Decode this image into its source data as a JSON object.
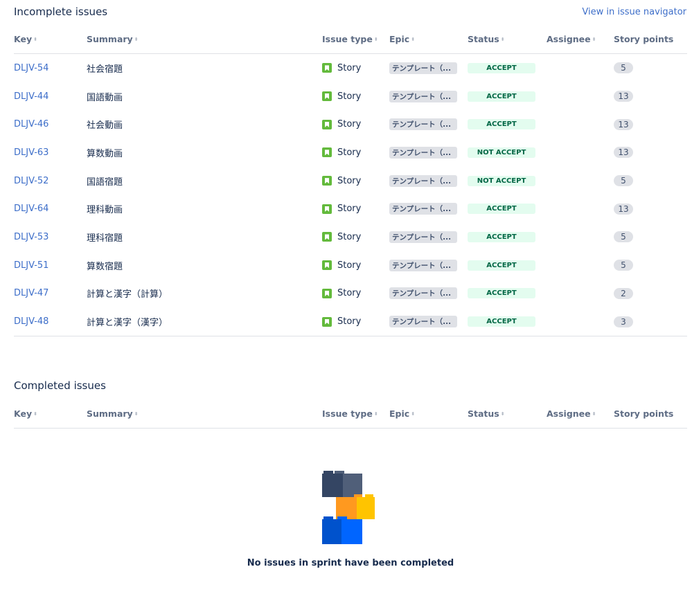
{
  "incomplete": {
    "title": "Incomplete issues",
    "nav_link": "View in issue navigator",
    "headers": {
      "key": "Key",
      "summary": "Summary",
      "issue_type": "Issue type",
      "epic": "Epic",
      "status": "Status",
      "assignee": "Assignee",
      "story_points": "Story points"
    },
    "rows": [
      {
        "key": "DLJV-54",
        "summary": "社会宿題",
        "type": "Story",
        "epic": "テンプレート（...",
        "status": "ACCEPT",
        "assignee": "",
        "points": "5"
      },
      {
        "key": "DLJV-44",
        "summary": "国語動画",
        "type": "Story",
        "epic": "テンプレート（...",
        "status": "ACCEPT",
        "assignee": "",
        "points": "13"
      },
      {
        "key": "DLJV-46",
        "summary": "社会動画",
        "type": "Story",
        "epic": "テンプレート（...",
        "status": "ACCEPT",
        "assignee": "",
        "points": "13"
      },
      {
        "key": "DLJV-63",
        "summary": "算数動画",
        "type": "Story",
        "epic": "テンプレート（...",
        "status": "NOT ACCEPT",
        "assignee": "",
        "points": "13"
      },
      {
        "key": "DLJV-52",
        "summary": "国語宿題",
        "type": "Story",
        "epic": "テンプレート（...",
        "status": "NOT ACCEPT",
        "assignee": "",
        "points": "5"
      },
      {
        "key": "DLJV-64",
        "summary": "理科動画",
        "type": "Story",
        "epic": "テンプレート（...",
        "status": "ACCEPT",
        "assignee": "",
        "points": "13"
      },
      {
        "key": "DLJV-53",
        "summary": "理科宿題",
        "type": "Story",
        "epic": "テンプレート（...",
        "status": "ACCEPT",
        "assignee": "",
        "points": "5"
      },
      {
        "key": "DLJV-51",
        "summary": "算数宿題",
        "type": "Story",
        "epic": "テンプレート（...",
        "status": "ACCEPT",
        "assignee": "",
        "points": "5"
      },
      {
        "key": "DLJV-47",
        "summary": "計算と漢字（計算）",
        "type": "Story",
        "epic": "テンプレート（...",
        "status": "ACCEPT",
        "assignee": "",
        "points": "2"
      },
      {
        "key": "DLJV-48",
        "summary": "計算と漢字（漢字）",
        "type": "Story",
        "epic": "テンプレート（...",
        "status": "ACCEPT",
        "assignee": "",
        "points": "3"
      }
    ]
  },
  "completed": {
    "title": "Completed issues",
    "headers": {
      "key": "Key",
      "summary": "Summary",
      "issue_type": "Issue type",
      "epic": "Epic",
      "status": "Status",
      "assignee": "Assignee",
      "story_points": "Story points"
    },
    "empty_message": "No issues in sprint have been completed",
    "empty_icon": "blocks-illustration"
  },
  "icons": {
    "story": "story-icon",
    "sort": "sort-icon"
  },
  "colors": {
    "link": "#3d6ec9",
    "story_icon": "#63ba3c",
    "status_bg": "#e3fcef",
    "status_text": "#006644",
    "lozenge_bg": "#dfe1e6"
  }
}
